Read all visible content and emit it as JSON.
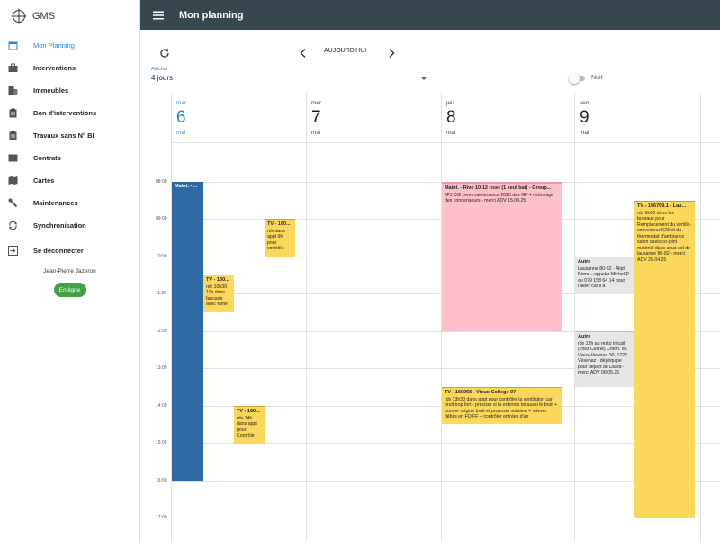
{
  "app": {
    "title": "GMS"
  },
  "sidebar": {
    "items": [
      {
        "label": "Mon Planning",
        "icon": "calendar-icon",
        "active": true
      },
      {
        "label": "Interventions",
        "icon": "briefcase-icon"
      },
      {
        "label": "Immeubles",
        "icon": "building-icon"
      },
      {
        "label": "Bon d'interventions",
        "icon": "clipboard-icon"
      },
      {
        "label": "Travaux sans N° BI",
        "icon": "clipboard-icon"
      },
      {
        "label": "Contrats",
        "icon": "book-icon"
      },
      {
        "label": "Cartes",
        "icon": "map-icon"
      },
      {
        "label": "Maintenances",
        "icon": "wrench-icon"
      },
      {
        "label": "Synchronisation",
        "icon": "sync-icon"
      },
      {
        "label": "Se déconnecter",
        "icon": "logout-icon"
      }
    ],
    "user": "Jean-Pierre Jazeron",
    "status": "En ligne"
  },
  "header": {
    "title": "Mon planning"
  },
  "toolbar": {
    "today_label": "AUJOURD'HUI",
    "display_label": "Afficher",
    "display_value": "4 jours",
    "night_label": "Nuit",
    "night_on": false
  },
  "calendar": {
    "days": [
      {
        "dow": "mar.",
        "num": "6",
        "month": "mai",
        "today": true
      },
      {
        "dow": "mer.",
        "num": "7",
        "month": "mai",
        "today": false
      },
      {
        "dow": "jeu.",
        "num": "8",
        "month": "mai",
        "today": false
      },
      {
        "dow": "ven.",
        "num": "9",
        "month": "mai",
        "today": false
      }
    ],
    "hours": [
      "08:00",
      "09:00",
      "10:00",
      "11:00",
      "12:00",
      "13:00",
      "14:00",
      "15:00",
      "16:00",
      "17:00"
    ],
    "events": [
      {
        "title": "Maint. - ...",
        "desc": "",
        "color": "blue"
      },
      {
        "title": "TV - 160...",
        "desc": "rdv dans appt 9h pour contrôle",
        "color": "yellow"
      },
      {
        "title": "TV - 160...",
        "desc": "rdv 10h30 11h dans fancade avec Mme",
        "color": "yellow"
      },
      {
        "title": "TV - 160...",
        "desc": "rdv 14h dans appt pour Contrôle",
        "color": "yellow"
      },
      {
        "title": "Maint. - Rive 10-12 (rue) (1 seul bat) - Group...",
        "desc": "JPJ DG 1ere maintenance 2025 des GF + nettoyage des condenseurs - merci ADV 15.04.25",
        "color": "pink"
      },
      {
        "title": "TV - 160065 - Vieux-College 07",
        "desc": "rdv 13h30 dans appt pour contrôler la ventilation car bruit trop fort - préciser si tu entends toi aussi le bruit + trouver origine bruit et proposer solution + relever débits en FO FF + contrôler entrées d'air",
        "color": "yellow"
      },
      {
        "title": "Autre",
        "desc": "Lausanne 80-82 - Aliph Bème - appeler Michel P. au 079 158 64 14 pour l'aider car il a",
        "color": "grey"
      },
      {
        "title": "Autre",
        "desc": "rdv 12h au resto Inicail (chez Celine) Chem. du Vieux-Veveraz 30, 1222 Vésenaz - déj équipe pour départ de David - merci ADV 06.05.25",
        "color": "grey"
      },
      {
        "title": "TV - 156769.1 - Lau...",
        "desc": "rdv 9h00 dans les bureaux pour Remplacement du ventilo-convecteur K23 et du thermostat d'ambiance salon davis co-joint - matériel dans sous-sol de lausanne 80-82 - merci ADV 25.04.25",
        "color": "yellow"
      }
    ]
  }
}
